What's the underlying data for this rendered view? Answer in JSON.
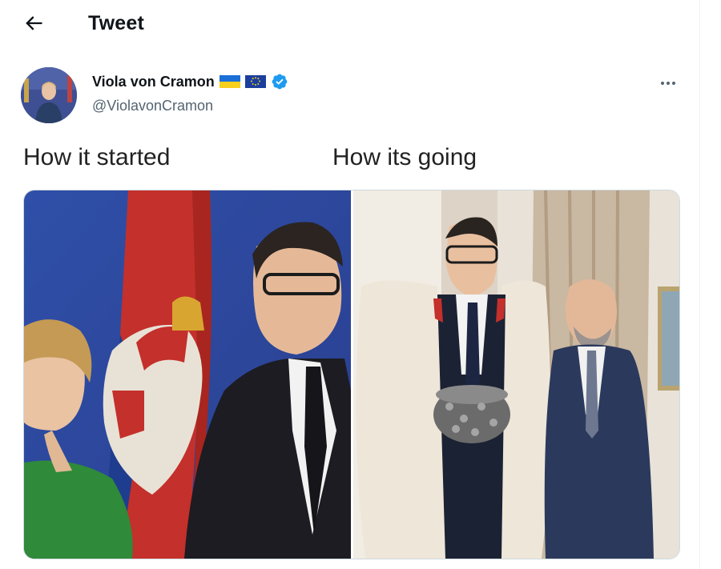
{
  "header": {
    "title": "Tweet"
  },
  "author": {
    "name": "Viola von Cramon",
    "handle": "@ViolavonCramon",
    "flags": [
      "ukraine-flag",
      "eu-flag"
    ],
    "verified": true
  },
  "tweet": {
    "caption_left": "How it started",
    "caption_right": "How its going"
  },
  "colors": {
    "verified": "#1d9bf0",
    "muted_text": "#536471",
    "border": "#cfd9de"
  },
  "icons": [
    "back-arrow-icon",
    "verified-badge-icon",
    "more-options-icon"
  ]
}
